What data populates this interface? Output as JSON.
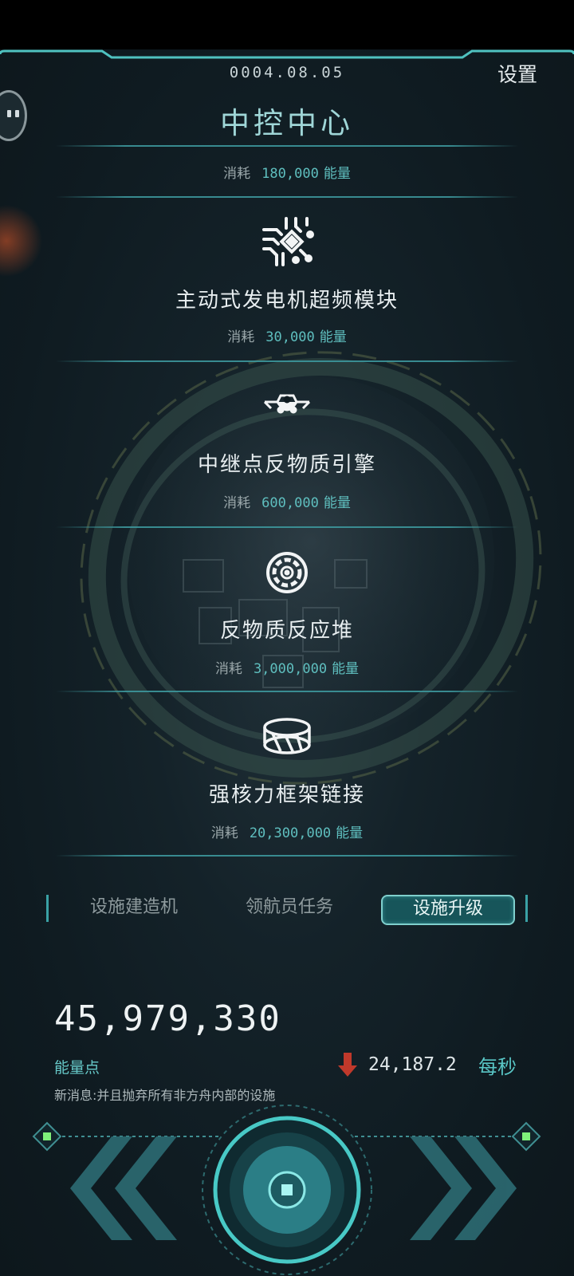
{
  "header": {
    "date": "0004.08.05",
    "settings_label": "设置",
    "title": "中控中心"
  },
  "title_cost": {
    "label": "消耗",
    "amount": "180,000",
    "unit": "能量"
  },
  "upgrades": [
    {
      "icon": "circuit-chip-icon",
      "name": "主动式发电机超频模块",
      "cost_label": "消耗",
      "amount": "30,000",
      "unit": "能量"
    },
    {
      "icon": "drone-engine-icon",
      "name": "中继点反物质引擎",
      "cost_label": "消耗",
      "amount": "600,000",
      "unit": "能量"
    },
    {
      "icon": "reactor-ring-icon",
      "name": "反物质反应堆",
      "cost_label": "消耗",
      "amount": "3,000,000",
      "unit": "能量"
    },
    {
      "icon": "ring-frame-icon",
      "name": "强核力框架链接",
      "cost_label": "消耗",
      "amount": "20,300,000",
      "unit": "能量"
    }
  ],
  "tabs": [
    {
      "label": "设施建造机",
      "active": false
    },
    {
      "label": "领航员任务",
      "active": false
    },
    {
      "label": "设施升级",
      "active": true
    }
  ],
  "status": {
    "energy_total": "45,979,330",
    "energy_label": "能量点",
    "rate_value": "24,187.2",
    "rate_unit": "每秒",
    "message": "新消息:并且抛弃所有非方舟内部的设施"
  },
  "colors": {
    "accent": "#5fc4c4",
    "background": "#14222a",
    "rate_arrow": "#c0392b"
  }
}
